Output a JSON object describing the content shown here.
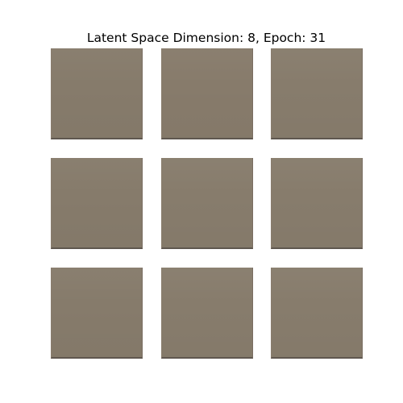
{
  "figure": {
    "title": "Latent Space Dimension: 8, Epoch: 31"
  },
  "samples": {
    "colors": [
      "#867b6b",
      "#877b6b",
      "#877c6c",
      "#867b6b",
      "#877c6c",
      "#877c6c",
      "#867b6b",
      "#877c6c",
      "#877c6c"
    ]
  }
}
